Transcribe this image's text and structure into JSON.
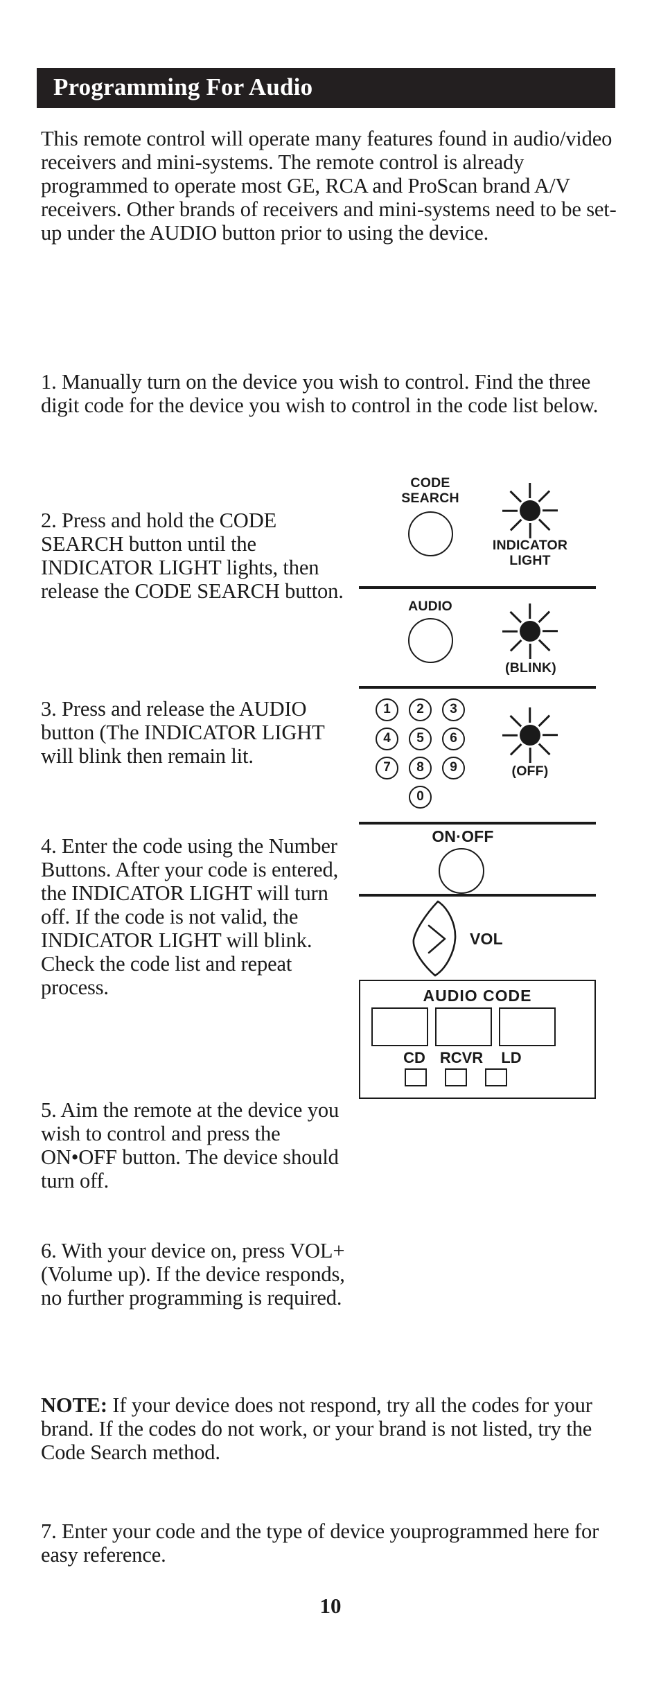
{
  "header": {
    "title": "Programming For Audio"
  },
  "content": {
    "intro": "This remote control will operate many features found in audio/video receivers and mini-systems. The remote control is already programmed to operate most GE, RCA and ProScan brand A/V receivers. Other brands of receivers and mini-systems need to be set-up under the AUDIO button prior to using the device.",
    "step_1": "1.   Manually turn on the device you wish to control. Find the three digit code for the device you wish to control in the code list below.",
    "step_2": "2.   Press and hold the CODE SEARCH button until the INDICATOR LIGHT lights, then release the CODE SEARCH button.",
    "step_3": "3.   Press and release the AUDIO button (The INDICATOR LIGHT will blink then remain lit.",
    "step_4": "4.   Enter the code using the Number Buttons. After your code is entered, the INDICATOR LIGHT will turn off. If the code is not valid, the INDICATOR LIGHT will blink. Check the code list and repeat process.",
    "step_5": "5.   Aim the remote at the device you wish to control and press the ON•OFF button. The device should turn off.",
    "step_6": "6.   With your device on, press VOL+ (Volume up). If the device responds, no further programming is required.",
    "note_label": "NOTE:",
    "note_text": " If your device does not respond, try all the codes for your brand. If the codes do not work, or your brand is not listed, try the Code Search method.",
    "step_7": "7.   Enter your code and the type of device youprogrammed here for easy reference.",
    "page_number": "10"
  },
  "diagram": {
    "section_code_search": {
      "button_label_line1": "CODE",
      "button_label_line2": "SEARCH",
      "indicator_label_line1": "INDICATOR",
      "indicator_label_line2": "LIGHT"
    },
    "section_audio": {
      "button_label": "AUDIO",
      "indicator_label": "(BLINK)"
    },
    "section_numbers": {
      "keys": [
        "1",
        "2",
        "3",
        "4",
        "5",
        "6",
        "7",
        "8",
        "9",
        "0"
      ],
      "indicator_label": "(OFF)"
    },
    "section_onoff": {
      "button_label": "ON·OFF"
    },
    "section_vol": {
      "label": "VOL"
    },
    "section_audio_code": {
      "title": "AUDIO CODE",
      "device_labels": [
        "CD",
        "RCVR",
        "LD"
      ],
      "code_values": [
        "",
        "",
        ""
      ],
      "checkbox_values": [
        "",
        "",
        ""
      ]
    }
  },
  "colors": {
    "ink": "#1a1a1a",
    "header_bar": "#231f20",
    "header_text": "#ffffff",
    "page_background": "#ffffff"
  }
}
